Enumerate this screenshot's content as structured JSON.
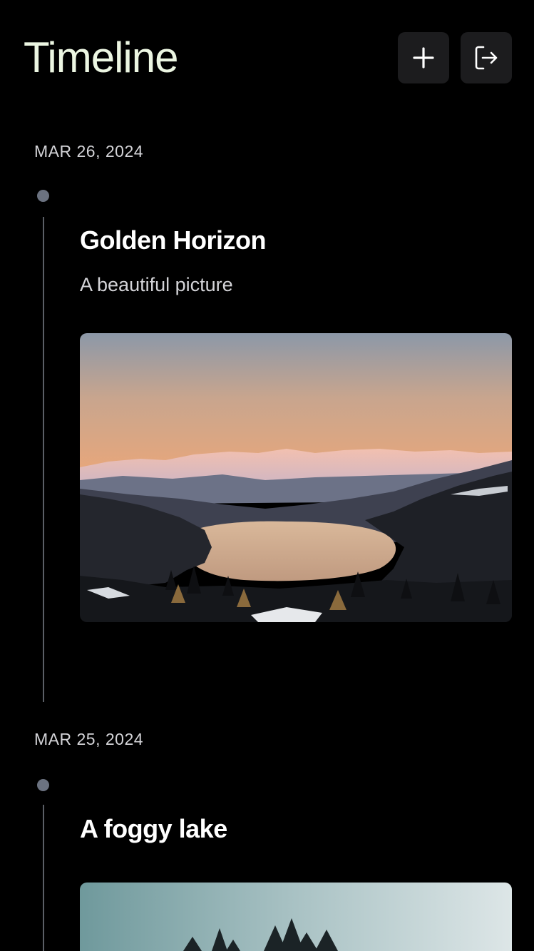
{
  "header": {
    "title": "Timeline",
    "add_icon": "plus-icon",
    "logout_icon": "logout-icon"
  },
  "entries": [
    {
      "date": "MAR 26, 2024",
      "title": "Golden Horizon",
      "description": "A beautiful picture",
      "photo": "mountain-lake-sunset"
    },
    {
      "date": "MAR 25, 2024",
      "title": "A foggy lake",
      "photo": "foggy-lake-trees"
    }
  ],
  "colors": {
    "background": "#000000",
    "title": "#ecf6e2",
    "button_bg": "#1c1c1e",
    "dot": "#6b7280",
    "timeline_line": "#5b5f66",
    "muted_text": "#d4d4d8"
  }
}
